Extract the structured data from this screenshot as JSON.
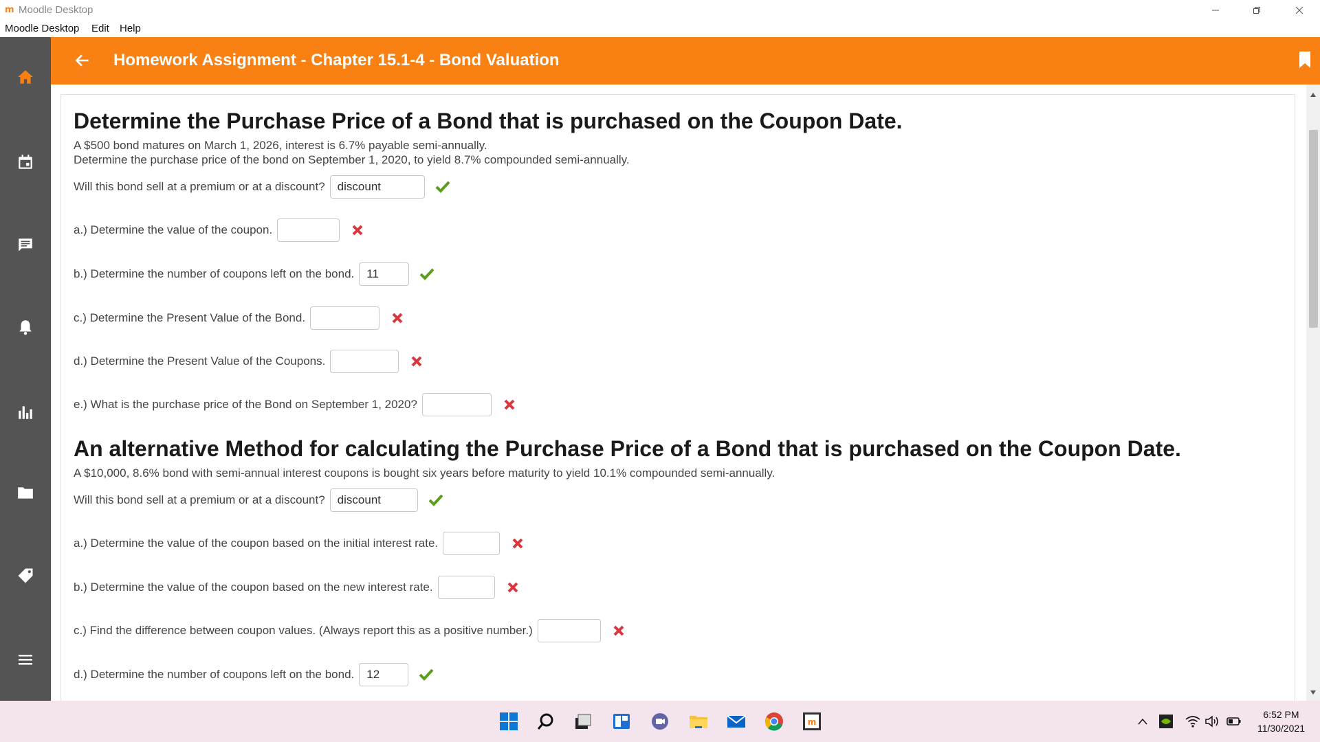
{
  "window": {
    "title": "Moodle Desktop",
    "app_logo": "m"
  },
  "menu": {
    "items": [
      "Moodle Desktop",
      "Edit",
      "Help"
    ]
  },
  "header": {
    "title": "Homework Assignment - Chapter 15.1-4 - Bond Valuation"
  },
  "colors": {
    "accent": "#f98012",
    "sidebar": "#545454",
    "correct": "#5a9e1a",
    "incorrect": "#d9363e"
  },
  "section1": {
    "heading": "Determine the Purchase Price of a Bond that is purchased on the Coupon Date.",
    "desc1": "A $500 bond matures on March 1, 2026, interest is 6.7% payable semi-annually.",
    "desc2": "Determine the purchase price of the bond on September 1, 2020, to yield 8.7% compounded semi-annually.",
    "questions": [
      {
        "label": "Will this bond sell at a premium or at a discount?",
        "value": "discount",
        "status": "correct"
      },
      {
        "label": "a.) Determine the value of the coupon.",
        "value": "",
        "status": "incorrect"
      },
      {
        "label": "b.) Determine the number of coupons left on the bond.",
        "value": "11",
        "status": "correct"
      },
      {
        "label": "c.) Determine the Present Value of the Bond.",
        "value": "",
        "status": "incorrect"
      },
      {
        "label": "d.) Determine the Present Value of the Coupons.",
        "value": "",
        "status": "incorrect"
      },
      {
        "label": "e.) What is the purchase price of the Bond on September 1, 2020?",
        "value": "",
        "status": "incorrect"
      }
    ]
  },
  "section2": {
    "heading": "An alternative Method for calculating the Purchase Price of a Bond that is purchased on the Coupon Date.",
    "desc1": "A $10,000, 8.6% bond with semi-annual interest coupons is bought six years before maturity to yield 10.1% compounded semi-annually.",
    "questions": [
      {
        "label": "Will this bond sell at a premium or at a discount?",
        "value": "discount",
        "status": "correct"
      },
      {
        "label": "a.) Determine the value of the coupon based on the initial interest rate.",
        "value": "",
        "status": "incorrect"
      },
      {
        "label": "b.) Determine the value of the coupon based on the new interest rate.",
        "value": "",
        "status": "incorrect"
      },
      {
        "label": "c.) Find the difference between coupon values. (Always report this as a positive number.)",
        "value": "",
        "status": "incorrect"
      },
      {
        "label": "d.) Determine the number of coupons left on the bond.",
        "value": "12",
        "status": "correct"
      }
    ]
  },
  "taskbar": {
    "time": "6:52 PM",
    "date": "11/30/2021"
  }
}
